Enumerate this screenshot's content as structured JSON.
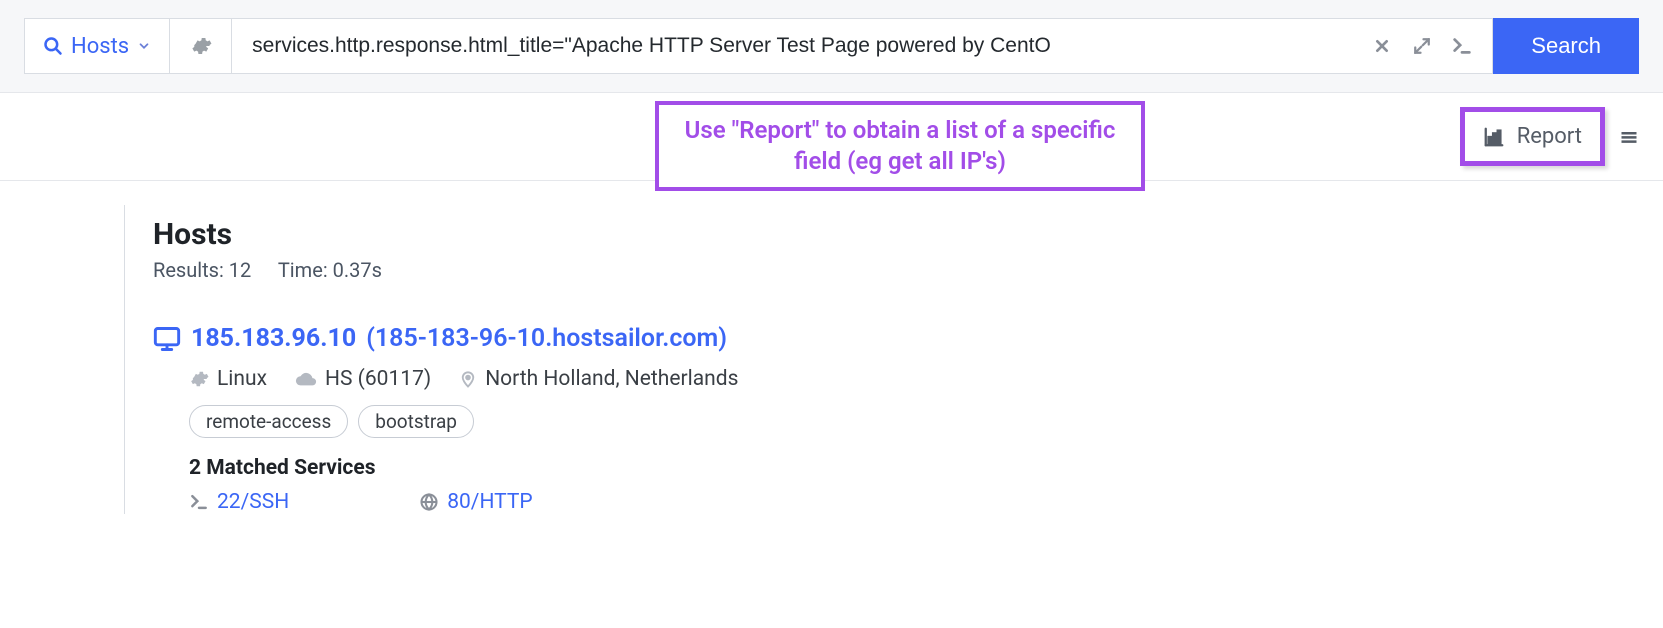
{
  "topbar": {
    "hosts_dd_label": "Hosts",
    "query_value": "services.http.response.html_title=\"Apache HTTP Server Test Page powered by CentO",
    "search_label": "Search"
  },
  "callout_text": "Use \"Report\" to obtain a list of a specific field (eg get all IP's)",
  "report_label": "Report",
  "results": {
    "heading": "Hosts",
    "count_label": "Results: 12",
    "time_label": "Time: 0.37s"
  },
  "host": {
    "ip": "185.183.96.10",
    "rdns": "(185-183-96-10.hostsailor.com)",
    "os": "Linux",
    "asn": "HS (60117)",
    "location": "North Holland, Netherlands",
    "tags": [
      "remote-access",
      "bootstrap"
    ],
    "matched_heading": "2 Matched Services",
    "services": [
      {
        "label": "22/SSH",
        "icon": "terminal"
      },
      {
        "label": "80/HTTP",
        "icon": "globe"
      }
    ]
  }
}
